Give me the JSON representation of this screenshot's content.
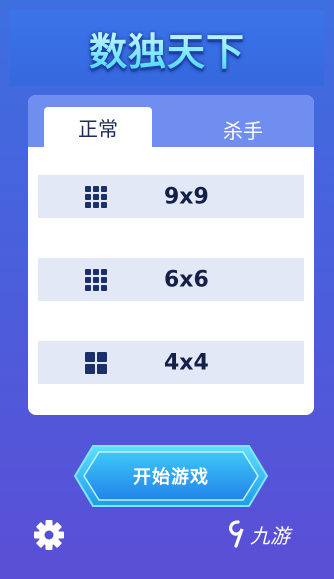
{
  "app": {
    "title": "数独天下"
  },
  "tabs": [
    {
      "label": "正常",
      "active": true
    },
    {
      "label": "杀手",
      "active": false
    }
  ],
  "modes": [
    {
      "label": "9x9",
      "icon": "grid-3x3-icon"
    },
    {
      "label": "6x6",
      "icon": "grid-3x3-icon"
    },
    {
      "label": "4x4",
      "icon": "grid-2x2-icon"
    }
  ],
  "start_button": {
    "label": "开始游戏"
  },
  "settings": {
    "icon": "gear-icon"
  },
  "watermark": {
    "mark": "9",
    "text": "九游"
  },
  "colors": {
    "background_top": "#3d6fe0",
    "background_bottom": "#5a4fd6",
    "title": "#7fe8ff",
    "card": "#ffffff",
    "row": "#e3e8f6",
    "row_text": "#14204a",
    "button": "#2bb8f0"
  }
}
